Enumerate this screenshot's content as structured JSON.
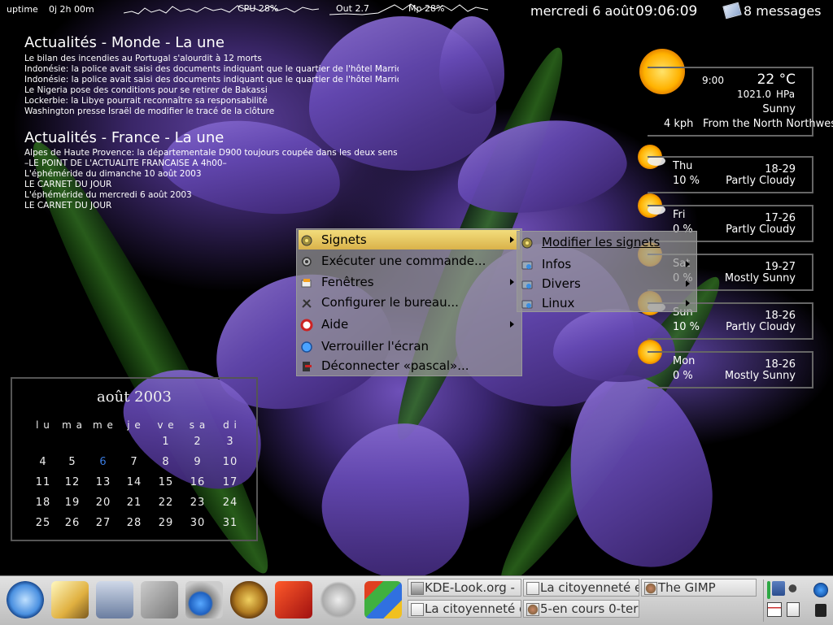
{
  "topbar": {
    "uptime_label": "uptime",
    "uptime_value": "0j 2h 00m",
    "cpu_label": "CPU 28%",
    "out_label": "Out 2.7",
    "mem_label": "Mp 28%",
    "date": "mercredi 6 août",
    "time": "09:06:09",
    "messages": "8 messages"
  },
  "news": [
    {
      "title": "Actualités - Monde - La une",
      "items": [
        "Le bilan des incendies au Portugal s'alourdit à 12 morts",
        "Indonésie: la police avait saisi des documents indiquant que le quartier de l'hôtel Marriott ét",
        "Indonésie: la police avait saisi des documents indiquant que le quartier de l'hôtel Marriott ét",
        "Le Nigeria pose des conditions pour se retirer de Bakassi",
        "Lockerbie: la Libye pourrait reconnaître sa responsabilité",
        "Washington presse Israël de modifier le tracé de la clôture"
      ]
    },
    {
      "title": "Actualités - France - La une",
      "items": [
        "Alpes de Haute Provence: la départementale D900 toujours coupée dans les deux sens en ra",
        "–LE POINT DE L'ACTUALITE FRANCAISE A 4h00–",
        "L'éphéméride du dimanche 10 août 2003",
        "LE CARNET DU JOUR",
        "L'éphéméride du mercredi 6 août 2003",
        "LE CARNET DU JOUR"
      ]
    }
  ],
  "calendar": {
    "title": "août 2003",
    "weekdays": [
      "l u",
      "m a",
      "m e",
      "j e",
      "v e",
      "s a",
      "d i"
    ],
    "weeks": [
      [
        "",
        "",
        "",
        "",
        "1",
        "2",
        "3"
      ],
      [
        "4",
        "5",
        "6",
        "7",
        "8",
        "9",
        "10"
      ],
      [
        "11",
        "12",
        "13",
        "14",
        "15",
        "16",
        "17"
      ],
      [
        "18",
        "19",
        "20",
        "21",
        "22",
        "23",
        "24"
      ],
      [
        "25",
        "26",
        "27",
        "28",
        "29",
        "30",
        "31"
      ]
    ],
    "today": "6",
    "today_color": "#3a7be0"
  },
  "weather": {
    "current": {
      "time": "9:00",
      "temp": "22 °C",
      "pressure_value": "1021.0",
      "pressure_unit": "HPa",
      "condition": "Sunny",
      "wind_speed": "4 kph",
      "wind_dir": "From the North Northwest"
    },
    "forecast": [
      {
        "day": "Thu",
        "range": "18-29",
        "precip": "10 %",
        "condition": "Partly Cloudy",
        "icon": "partly-cloudy-icon"
      },
      {
        "day": "Fri",
        "range": "17-26",
        "precip": "0 %",
        "condition": "Partly Cloudy",
        "icon": "partly-cloudy-icon"
      },
      {
        "day": "Sat",
        "range": "19-27",
        "precip": "0 %",
        "condition": "Mostly Sunny",
        "icon": "mostly-sunny-icon"
      },
      {
        "day": "Sun",
        "range": "18-26",
        "precip": "10 %",
        "condition": "Partly Cloudy",
        "icon": "partly-cloudy-icon"
      },
      {
        "day": "Mon",
        "range": "18-26",
        "precip": "0 %",
        "condition": "Mostly Sunny",
        "icon": "mostly-sunny-icon"
      }
    ]
  },
  "context_menu": {
    "items": [
      {
        "label": "Signets",
        "icon": "bookmarks-icon",
        "submenu": true
      },
      {
        "label": "Exécuter une commande...",
        "icon": "run-command-icon",
        "submenu": false
      },
      {
        "label": "Fenêtres",
        "icon": "windows-icon",
        "submenu": true
      },
      {
        "label": "Configurer le bureau...",
        "icon": "configure-icon",
        "submenu": false
      },
      {
        "label": "Aide",
        "icon": "help-icon",
        "submenu": true
      },
      {
        "label": "Verrouiller l'écran",
        "icon": "lock-screen-icon",
        "submenu": false
      },
      {
        "label": "Déconnecter «pascal»...",
        "icon": "logout-icon",
        "submenu": false
      }
    ],
    "highlight_color": "#e8c860"
  },
  "bookmarks_menu": {
    "items": [
      {
        "label": "Modifier les signets",
        "icon": "edit-bookmarks-icon",
        "submenu": false
      },
      {
        "label": "Infos",
        "icon": "folder-icon",
        "submenu": true
      },
      {
        "label": "Divers",
        "icon": "folder-icon",
        "submenu": true
      },
      {
        "label": "Linux",
        "icon": "folder-icon",
        "submenu": true
      }
    ]
  },
  "taskbar": {
    "quick_launch": [
      "kde-menu-icon",
      "editor-icon",
      "terminal-icon",
      "control-center-icon",
      "file-manager-icon",
      "kde-settings-icon",
      "mozilla-icon",
      "show-desktop-icon",
      "windows-icon"
    ],
    "tasks": [
      {
        "label": "KDE-Look.org - ",
        "icon": "kde-look-icon"
      },
      {
        "label": "La citoyenneté e",
        "icon": "document-icon"
      },
      {
        "label": "The GIMP",
        "icon": "gimp-icon"
      },
      {
        "label": "La citoyenneté e",
        "icon": "document-icon"
      },
      {
        "label": "5-en cours 0-ter",
        "icon": "gimp-icon"
      }
    ]
  }
}
